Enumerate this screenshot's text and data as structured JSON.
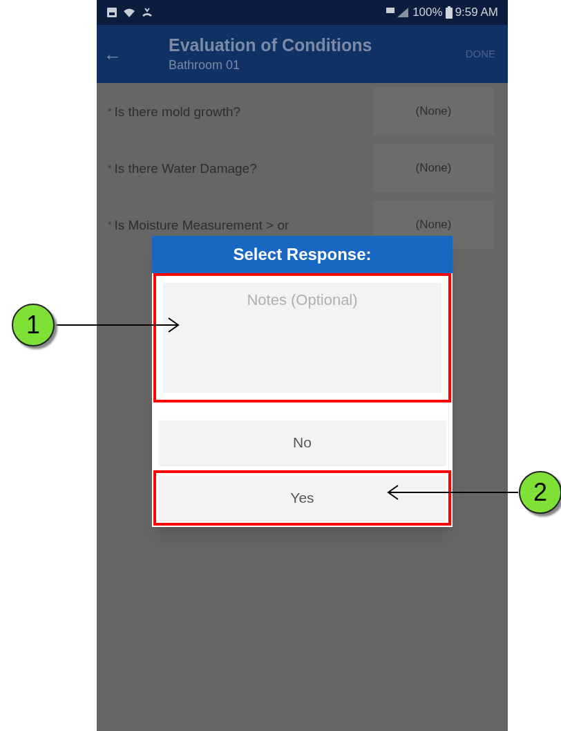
{
  "status_bar": {
    "battery": "100%",
    "time": "9:59 AM"
  },
  "app_bar": {
    "back": "←",
    "title": "Evaluation of Conditions",
    "subtitle": "Bathroom 01",
    "action": "DONE"
  },
  "questions": [
    {
      "required": "*",
      "label": "Is there mold growth?",
      "value": "(None)"
    },
    {
      "required": "*",
      "label": "Is there Water Damage?",
      "value": "(None)"
    },
    {
      "required": "*",
      "label": "Is Moisture Measurement > or",
      "value": "(None)"
    }
  ],
  "dialog": {
    "title": "Select Response:",
    "notes": {
      "placeholder": "Notes (Optional)",
      "highlighted": true
    },
    "options": [
      {
        "label": "No",
        "highlighted": false
      },
      {
        "label": "Yes",
        "highlighted": true
      }
    ]
  },
  "callouts": [
    {
      "number": "1"
    },
    {
      "number": "2"
    }
  ]
}
